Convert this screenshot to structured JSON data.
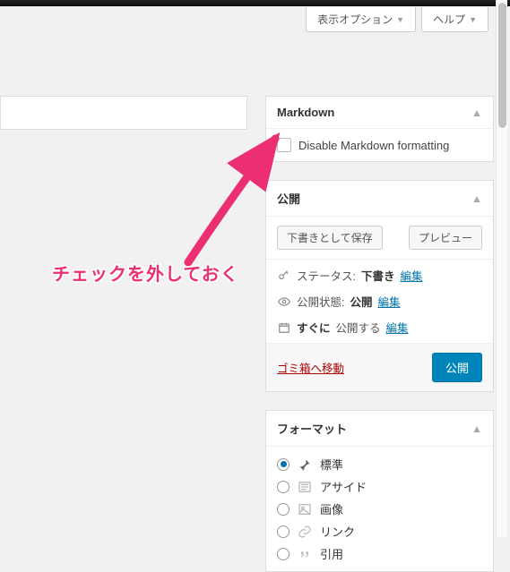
{
  "screenOptions": {
    "displayOptions": "表示オプション",
    "help": "ヘルプ"
  },
  "markdown": {
    "title": "Markdown",
    "disableLabel": "Disable Markdown formatting"
  },
  "publish": {
    "title": "公開",
    "saveDraft": "下書きとして保存",
    "preview": "プレビュー",
    "statusLabel": "ステータス:",
    "statusValue": "下書き",
    "visibilityLabel": "公開状態:",
    "visibilityValue": "公開",
    "scheduleLabel": "すぐに",
    "scheduleSuffix": "公開する",
    "editLink": "編集",
    "trash": "ゴミ箱へ移動",
    "publishBtn": "公開"
  },
  "format": {
    "title": "フォーマット",
    "options": [
      {
        "label": "標準",
        "selected": true,
        "iconGlyph": "📌"
      },
      {
        "label": "アサイド",
        "selected": false,
        "iconGlyph": "≡"
      },
      {
        "label": "画像",
        "selected": false,
        "iconGlyph": "▣"
      },
      {
        "label": "リンク",
        "selected": false,
        "iconGlyph": "🔗"
      },
      {
        "label": "引用",
        "selected": false,
        "iconGlyph": "❝"
      }
    ]
  },
  "annotation": {
    "text": "チェックを外しておく"
  }
}
